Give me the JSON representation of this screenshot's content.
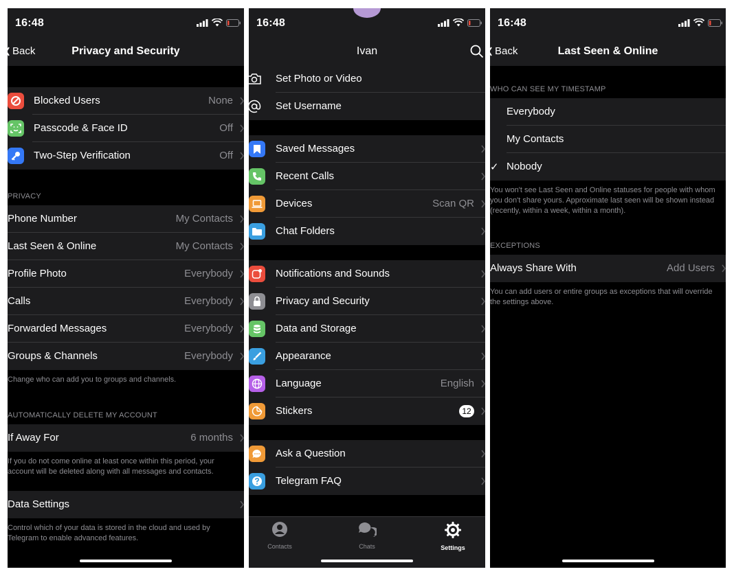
{
  "status": {
    "time": "16:48"
  },
  "privacy_screen": {
    "back_label": "Back",
    "title": "Privacy and Security",
    "security_rows": [
      {
        "label": "Blocked Users",
        "value": "None",
        "icon": "blocked-icon",
        "color": "#eb4d3d"
      },
      {
        "label": "Passcode & Face ID",
        "value": "Off",
        "icon": "face-id-icon",
        "color": "#65c466"
      },
      {
        "label": "Two-Step Verification",
        "value": "Off",
        "icon": "key-icon",
        "color": "#3478f6"
      }
    ],
    "privacy_header": "PRIVACY",
    "privacy_rows": [
      {
        "label": "Phone Number",
        "value": "My Contacts"
      },
      {
        "label": "Last Seen & Online",
        "value": "My Contacts"
      },
      {
        "label": "Profile Photo",
        "value": "Everybody"
      },
      {
        "label": "Calls",
        "value": "Everybody"
      },
      {
        "label": "Forwarded Messages",
        "value": "Everybody"
      },
      {
        "label": "Groups & Channels",
        "value": "Everybody"
      }
    ],
    "privacy_footer": "Change who can add you to groups and channels.",
    "delete_header": "AUTOMATICALLY DELETE MY ACCOUNT",
    "delete_row": {
      "label": "If Away For",
      "value": "6 months"
    },
    "delete_footer": "If you do not come online at least once within this period, your account will be deleted along with all messages and contacts.",
    "data_row": {
      "label": "Data Settings"
    },
    "data_footer": "Control which of your data is stored in the cloud and used by Telegram to enable advanced features."
  },
  "settings_screen": {
    "title": "Ivan",
    "profile_rows": [
      {
        "label": "Set Photo or Video",
        "icon": "camera-icon"
      },
      {
        "label": "Set Username",
        "icon": "at-sign-icon"
      }
    ],
    "group1": [
      {
        "label": "Saved Messages",
        "value": "",
        "icon": "bookmark-icon",
        "color": "#3478f6"
      },
      {
        "label": "Recent Calls",
        "value": "",
        "icon": "phone-icon",
        "color": "#65c466"
      },
      {
        "label": "Devices",
        "value": "Scan QR",
        "icon": "laptop-icon",
        "color": "#f09a37"
      },
      {
        "label": "Chat Folders",
        "value": "",
        "icon": "folder-icon",
        "color": "#3a9fe0"
      }
    ],
    "group2": [
      {
        "label": "Notifications and Sounds",
        "value": "",
        "icon": "notification-icon",
        "color": "#eb4d3d"
      },
      {
        "label": "Privacy and Security",
        "value": "",
        "icon": "lock-icon",
        "color": "#8e8e93"
      },
      {
        "label": "Data and Storage",
        "value": "",
        "icon": "database-icon",
        "color": "#65c466"
      },
      {
        "label": "Appearance",
        "value": "",
        "icon": "brush-icon",
        "color": "#3a9fe0"
      },
      {
        "label": "Language",
        "value": "English",
        "icon": "globe-icon",
        "color": "#b660e8"
      },
      {
        "label": "Stickers",
        "value": "12",
        "icon": "sticker-icon",
        "color": "#f09a37"
      }
    ],
    "group3": [
      {
        "label": "Ask a Question",
        "icon": "chat-bubble-icon",
        "color": "#f09a37"
      },
      {
        "label": "Telegram FAQ",
        "icon": "question-icon",
        "color": "#3a9fe0"
      }
    ],
    "tabs": [
      {
        "label": "Contacts",
        "icon": "contacts-icon",
        "active": false
      },
      {
        "label": "Chats",
        "icon": "chats-icon",
        "active": false
      },
      {
        "label": "Settings",
        "icon": "settings-gear-icon",
        "active": true
      }
    ]
  },
  "last_seen_screen": {
    "back_label": "Back",
    "title": "Last Seen & Online",
    "who_header": "WHO CAN SEE MY TIMESTAMP",
    "options": [
      {
        "label": "Everybody",
        "selected": false
      },
      {
        "label": "My Contacts",
        "selected": false
      },
      {
        "label": "Nobody",
        "selected": true
      }
    ],
    "check_glyph": "✓",
    "who_footer": "You won't see Last Seen and Online statuses for people with whom you don't share yours. Approximate last seen will be shown instead (recently, within a week, within a month).",
    "exceptions_header": "EXCEPTIONS",
    "always_share": {
      "label": "Always Share With",
      "value": "Add Users"
    },
    "exceptions_footer": "You can add users or entire groups as exceptions that will override the settings above."
  },
  "colors": {
    "background": "#000000",
    "cell": "#1c1c1e",
    "separator": "#38383a",
    "secondary_text": "#8e8e93",
    "accent_red": "#eb4d3d"
  }
}
